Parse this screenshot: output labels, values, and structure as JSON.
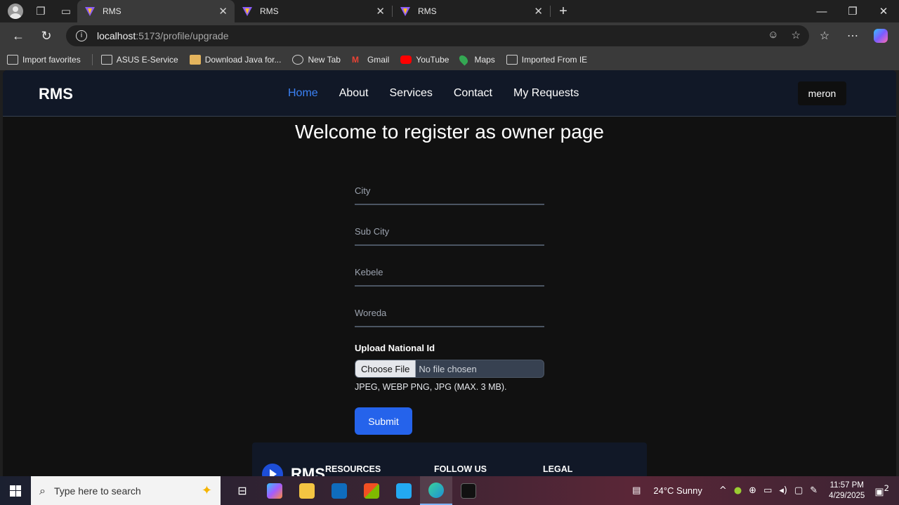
{
  "browser": {
    "tabs": [
      {
        "title": "RMS",
        "active": true
      },
      {
        "title": "RMS",
        "active": false
      },
      {
        "title": "RMS",
        "active": false
      }
    ],
    "url_host": "localhost",
    "url_path": ":5173/profile/upgrade",
    "favorites": [
      {
        "label": "Import favorites",
        "icon": "import-icon"
      },
      {
        "label": "ASUS E-Service",
        "icon": "folder-icon"
      },
      {
        "label": "Download Java for...",
        "icon": "java-icon"
      },
      {
        "label": "New Tab",
        "icon": "globe-icon"
      },
      {
        "label": "Gmail",
        "icon": "gmail-icon"
      },
      {
        "label": "YouTube",
        "icon": "youtube-icon"
      },
      {
        "label": "Maps",
        "icon": "maps-icon"
      },
      {
        "label": "Imported From IE",
        "icon": "folder-icon"
      }
    ]
  },
  "app": {
    "brand": "RMS",
    "nav": [
      {
        "label": "Home",
        "active": true
      },
      {
        "label": "About",
        "active": false
      },
      {
        "label": "Services",
        "active": false
      },
      {
        "label": "Contact",
        "active": false
      },
      {
        "label": "My Requests",
        "active": false
      }
    ],
    "user": "meron",
    "heading": "Welcome to register as owner page",
    "form": {
      "city_placeholder": "City",
      "subcity_placeholder": "Sub City",
      "kebele_placeholder": "Kebele",
      "woreda_placeholder": "Woreda",
      "upload_label": "Upload National Id",
      "choose_file": "Choose File",
      "no_file": "No file chosen",
      "hint": "JPEG, WEBP PNG, JPG (MAX. 3 MB).",
      "submit": "Submit"
    },
    "footer": {
      "brand": "RMS",
      "columns": [
        "RESOURCES",
        "FOLLOW US",
        "LEGAL"
      ]
    }
  },
  "taskbar": {
    "search_placeholder": "Type here to search",
    "weather": "24°C  Sunny",
    "time": "11:57 PM",
    "date": "4/29/2025",
    "notifications": "2"
  },
  "colors": {
    "accent": "#2563eb",
    "nav_active": "#3b82f6",
    "navbar_bg": "#111827",
    "page_bg": "#111111"
  }
}
